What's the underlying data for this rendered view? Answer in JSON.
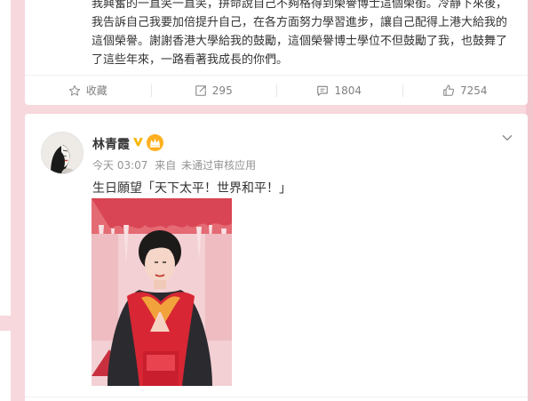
{
  "top_post": {
    "text": "我興奮的一直笑一直笑，拼命說自己不夠格得到榮譽博士這個榮銜。冷靜下來後，我告訴自己我要加倍提升自己，在各方面努力學習進步，讓自己配得上港大給我的這個榮譽。謝謝香港大學給我的鼓勵，這個榮譽博士學位不但鼓勵了我，也鼓舞了了這些年來，一路看著我成長的你們。",
    "actions": {
      "favorite": "收藏",
      "repost": "295",
      "comment": "1804",
      "like": "7254"
    }
  },
  "main_post": {
    "username": "林青霞",
    "time": "今天 03:07",
    "source_prefix": "来自",
    "source": "未通过审核应用",
    "content": "生日願望「天下太平！世界和平！」"
  },
  "colors": {
    "page_bg": "#f7d8dd",
    "text": "#333333",
    "meta": "#939393",
    "verified": "#f6b600",
    "crown": "#ffb020"
  },
  "icons": [
    "star-icon",
    "repost-icon",
    "comment-icon",
    "like-icon",
    "verified-icon",
    "crown-icon",
    "chevron-down-icon"
  ]
}
